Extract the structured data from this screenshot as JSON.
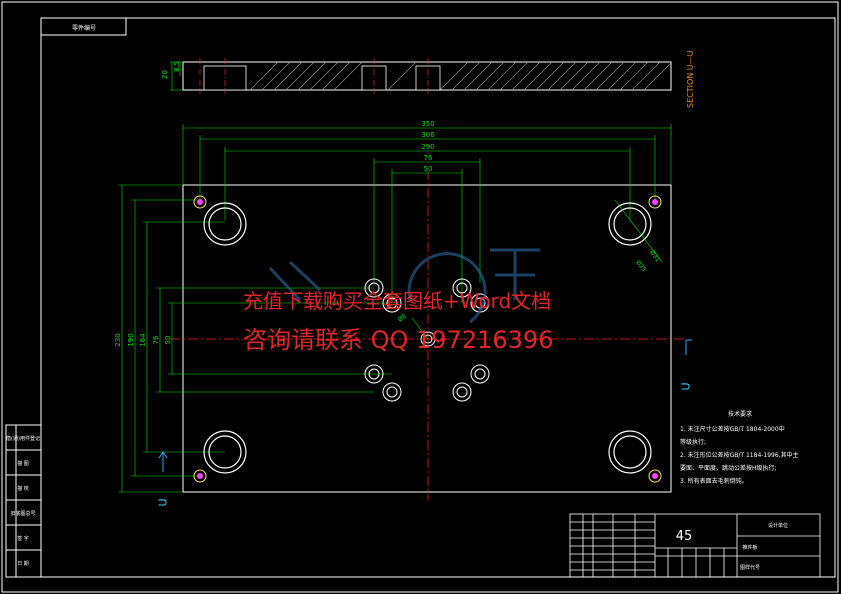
{
  "header_box_label": "零件编号",
  "section_label": "SECTION U—U",
  "cut_marker": "U",
  "section_dims": [
    "20",
    "8.5"
  ],
  "plan_dims": {
    "horizontal": [
      "350",
      "306",
      "290",
      "76",
      "50"
    ],
    "vertical": [
      "230",
      "190",
      "164",
      "76",
      "50"
    ],
    "diagonal": [
      "Ø25",
      "Ø31",
      "Ø8"
    ]
  },
  "watermark": {
    "line1": "充值下载购买全套图纸+Word文档",
    "line2": "咨询请联系 QQ 197216396"
  },
  "tech_notes": {
    "title": "技术要求",
    "items": [
      "1. 未注尺寸公差按GB/T 1804-2000中",
      "   等级执行;",
      "2. 未注形位公差按GB/T 1184-1996,其中主",
      "   要面、平面度、跳动公差按H级执行;",
      "3. 所有表面去毛刺倒钝。"
    ]
  },
  "title_block": {
    "material": "45",
    "school": "设计单位",
    "part_name": "推件板",
    "drawing_no": "图样代号"
  },
  "left_strip": [
    "借(通)用件登记",
    "描 图",
    "描 校",
    "旧底图总号",
    "签 字",
    "日 期"
  ],
  "colors": {
    "plate": "#ffffff",
    "dim": "#00e000",
    "center": "#ff2020",
    "hole": "#ffff60",
    "marker": "#30a8ff"
  }
}
